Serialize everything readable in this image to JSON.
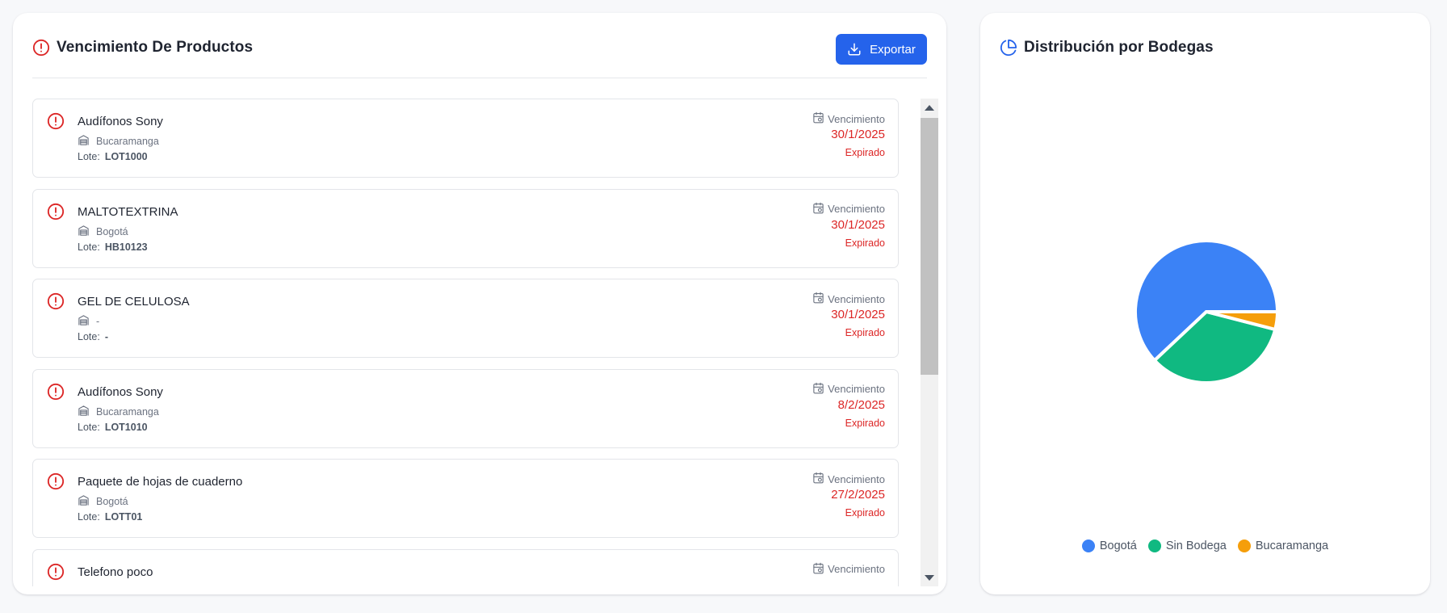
{
  "expiry_panel": {
    "title": "Vencimiento De Productos",
    "export_label": "Exportar",
    "items": [
      {
        "name": "Audífonos Sony",
        "warehouse": "Bucaramanga",
        "lot_label": "Lote:",
        "lot": "LOT1000",
        "expiry_label": "Vencimiento",
        "date": "30/1/2025",
        "status": "Expirado"
      },
      {
        "name": "MALTOTEXTRINA",
        "warehouse": "Bogotá",
        "lot_label": "Lote:",
        "lot": "HB10123",
        "expiry_label": "Vencimiento",
        "date": "30/1/2025",
        "status": "Expirado"
      },
      {
        "name": "GEL DE CELULOSA",
        "warehouse": "-",
        "lot_label": "Lote:",
        "lot": "-",
        "expiry_label": "Vencimiento",
        "date": "30/1/2025",
        "status": "Expirado"
      },
      {
        "name": "Audífonos Sony",
        "warehouse": "Bucaramanga",
        "lot_label": "Lote:",
        "lot": "LOT1010",
        "expiry_label": "Vencimiento",
        "date": "8/2/2025",
        "status": "Expirado"
      },
      {
        "name": "Paquete de hojas de cuaderno",
        "warehouse": "Bogotá",
        "lot_label": "Lote:",
        "lot": "LOTT01",
        "expiry_label": "Vencimiento",
        "date": "27/2/2025",
        "status": "Expirado"
      },
      {
        "name": "Telefono poco",
        "warehouse": "",
        "lot_label": "",
        "lot": "",
        "expiry_label": "Vencimiento",
        "date": "",
        "status": ""
      }
    ]
  },
  "distribution_panel": {
    "title": "Distribución por Bodegas"
  },
  "chart_data": {
    "type": "pie",
    "title": "Distribución por Bodegas",
    "categories": [
      "Bogotá",
      "Sin Bodega",
      "Bucaramanga"
    ],
    "values": [
      62,
      34,
      4
    ],
    "colors": [
      "#3b82f6",
      "#10b981",
      "#f59e0b"
    ],
    "legend_position": "bottom"
  },
  "colors": {
    "accent": "#2563eb",
    "danger": "#dc2626"
  }
}
